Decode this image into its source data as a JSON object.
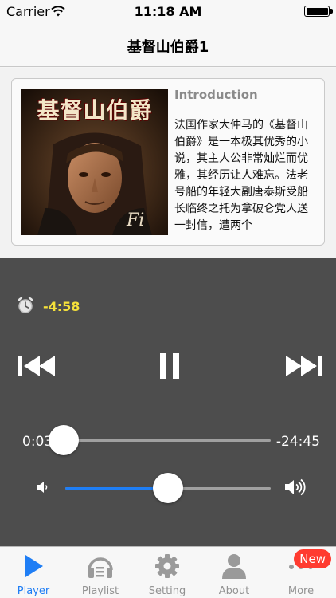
{
  "status_bar": {
    "carrier": "Carrier",
    "time": "11:18 AM",
    "battery_level": 1.0
  },
  "nav": {
    "title": "基督山伯爵1"
  },
  "intro": {
    "cover_title": "基督山伯爵",
    "heading": "Introduction",
    "text": "法国作家大仲马的《基督山伯爵》是一本极其优秀的小说，其主人公非常灿烂而优雅，其经历让人难忘。法老号船的年轻大副唐泰斯受船长临终之托为拿破仑党人送一封信，遭两个"
  },
  "player": {
    "countdown": "-4:58",
    "elapsed": "0:03",
    "remaining": "-24:45",
    "progress": 0.0,
    "volume": 0.5
  },
  "tabs": [
    {
      "label": "Player",
      "icon": "play-icon",
      "active": true
    },
    {
      "label": "Playlist",
      "icon": "headphones-icon",
      "active": false
    },
    {
      "label": "Setting",
      "icon": "gear-icon",
      "active": false
    },
    {
      "label": "About",
      "icon": "person-icon",
      "active": false
    },
    {
      "label": "More",
      "icon": "more-icon",
      "active": false,
      "badge": "New"
    }
  ],
  "colors": {
    "accent": "#1f7ef5",
    "countdown": "#f5e03a",
    "player_bg": "#4d4d4d",
    "badge": "#ff3b30"
  }
}
